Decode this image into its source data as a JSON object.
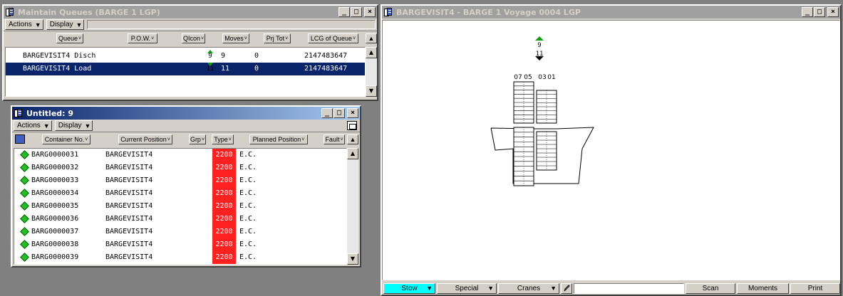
{
  "queues_window": {
    "title": "Maintain Queues (BARGE 1 LGP)",
    "menu": {
      "actions": "Actions",
      "display": "Display"
    },
    "columns": [
      "Queue",
      "P.O.W.",
      "QIcon",
      "Moves",
      "Prj Tot",
      "LCG of Queue"
    ],
    "rows": [
      {
        "name": "BARGEVISIT4 Disch",
        "qicon_num": "9",
        "moves": "9",
        "prj_tot": "0",
        "lcg": "2147483647",
        "selected": false
      },
      {
        "name": "BARGEVISIT4 Load",
        "qicon_num": "11",
        "moves": "11",
        "prj_tot": "0",
        "lcg": "2147483647",
        "selected": true
      }
    ]
  },
  "untitled_window": {
    "title": "Untitled: 9",
    "menu": {
      "actions": "Actions",
      "display": "Display"
    },
    "columns": [
      "Container No.",
      "Current Position",
      "Grp",
      "Type",
      "Planned Position",
      "Fault"
    ],
    "rows": [
      {
        "container": "BARG0000031",
        "position": "BARGEVISIT4",
        "type": "2200",
        "planned": "E.C."
      },
      {
        "container": "BARG0000032",
        "position": "BARGEVISIT4",
        "type": "2200",
        "planned": "E.C."
      },
      {
        "container": "BARG0000033",
        "position": "BARGEVISIT4",
        "type": "2200",
        "planned": "E.C."
      },
      {
        "container": "BARG0000034",
        "position": "BARGEVISIT4",
        "type": "2200",
        "planned": "E.C."
      },
      {
        "container": "BARG0000035",
        "position": "BARGEVISIT4",
        "type": "2200",
        "planned": "E.C."
      },
      {
        "container": "BARG0000036",
        "position": "BARGEVISIT4",
        "type": "2200",
        "planned": "E.C."
      },
      {
        "container": "BARG0000037",
        "position": "BARGEVISIT4",
        "type": "2200",
        "planned": "E.C."
      },
      {
        "container": "BARG0000038",
        "position": "BARGEVISIT4",
        "type": "2200",
        "planned": "E.C."
      },
      {
        "container": "BARG0000039",
        "position": "BARGEVISIT4",
        "type": "2200",
        "planned": "E.C."
      }
    ]
  },
  "barge_window": {
    "title": "BARGEVISIT4 - BARGE 1  Voyage 0004 LGP",
    "crane_top": "9",
    "crane_bottom": "11",
    "bay_labels": [
      "07",
      "05",
      "03",
      "01"
    ],
    "bottom": {
      "stow": "Stow",
      "special": "Special",
      "cranes": "Cranes",
      "scan": "Scan",
      "moments": "Moments",
      "print": "Print"
    }
  },
  "colors": {
    "selection": "#0a246a",
    "type_red": "#ff2020",
    "stow_active": "#00ffff",
    "status_green": "#20c020"
  },
  "window_controls": {
    "minimize": "_",
    "maximize": "□",
    "close": "×"
  },
  "icons": {
    "sort_marker": "˅",
    "scroll_up": "▲",
    "scroll_down": "▼",
    "menu_arrow": "▼"
  }
}
